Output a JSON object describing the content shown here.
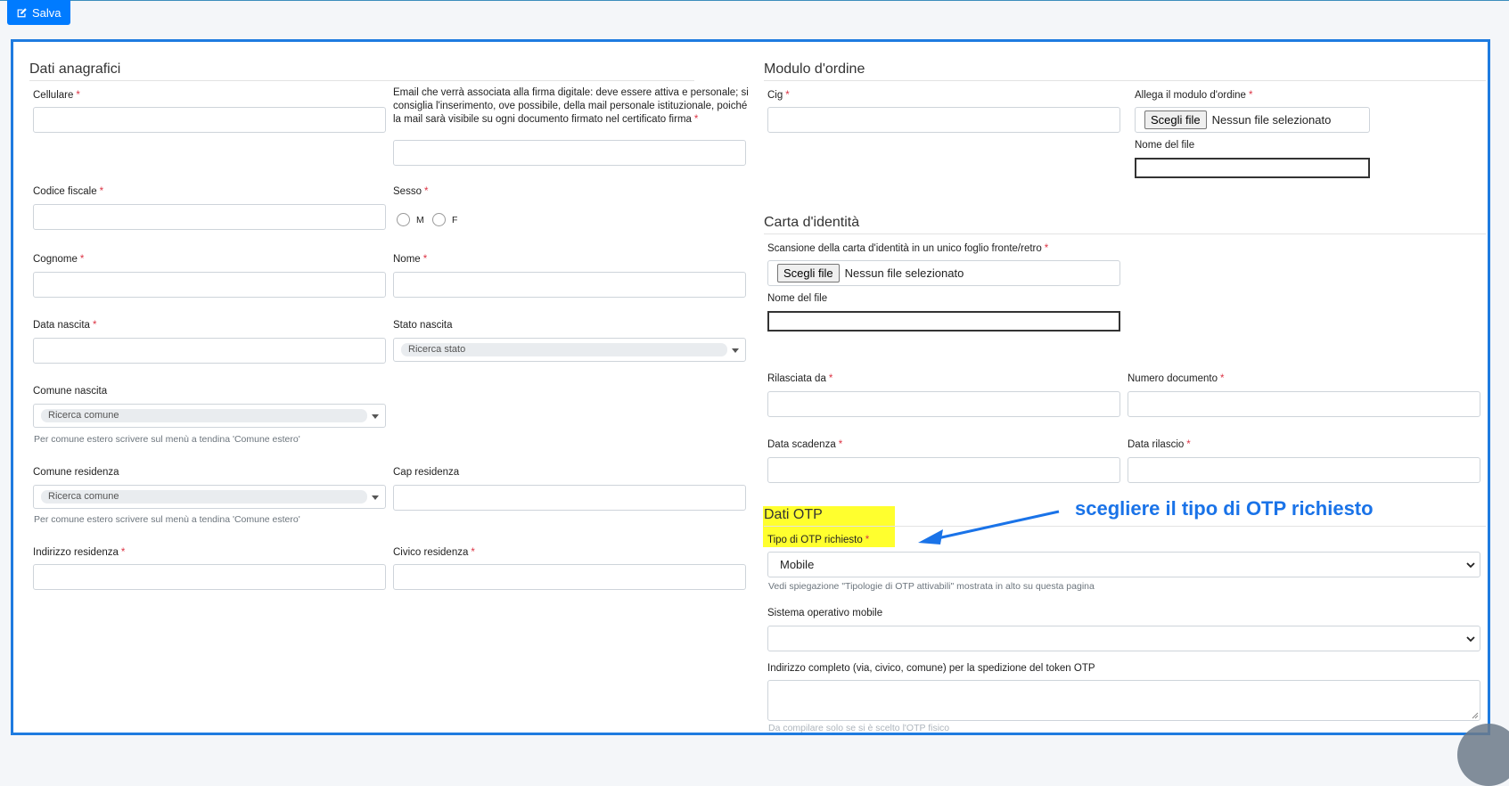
{
  "toolbar": {
    "save_label": "Salva"
  },
  "dati_anagrafici": {
    "title": "Dati anagrafici",
    "cellulare": "Cellulare",
    "email": "Email che verrà associata alla firma digitale: deve essere attiva e personale; si consiglia l'inserimento, ove possibile, della mail personale istituzionale, poiché la mail sarà visibile su ogni documento firmato nel certificato firma",
    "codice_fiscale": "Codice fiscale",
    "sesso": "Sesso",
    "sesso_m": "M",
    "sesso_f": "F",
    "cognome": "Cognome",
    "nome": "Nome",
    "data_nascita": "Data nascita",
    "stato_nascita": "Stato nascita",
    "stato_placeholder": "Ricerca stato",
    "comune_nascita": "Comune nascita",
    "comune_placeholder": "Ricerca comune",
    "comune_help": "Per comune estero scrivere sul menù a tendina 'Comune estero'",
    "comune_residenza": "Comune residenza",
    "cap_residenza": "Cap residenza",
    "indirizzo_residenza": "Indirizzo residenza",
    "civico_residenza": "Civico residenza",
    "required_mark": "*"
  },
  "modulo_ordine": {
    "title": "Modulo d'ordine",
    "cig": "Cig",
    "allega": "Allega il modulo d'ordine",
    "file_button": "Scegli file",
    "file_none": "Nessun file selezionato",
    "nome_file": "Nome del file"
  },
  "carta_identita": {
    "title": "Carta d'identità",
    "scansione": "Scansione della carta d'identità in un unico foglio fronte/retro",
    "nome_file": "Nome del file",
    "rilasciata_da": "Rilasciata da",
    "numero_documento": "Numero documento",
    "data_scadenza": "Data scadenza",
    "data_rilascio": "Data rilascio"
  },
  "dati_otp": {
    "title": "Dati OTP",
    "tipo_otp": "Tipo di OTP richiesto",
    "tipo_otp_value": "Mobile",
    "tipo_otp_help": "Vedi spiegazione \"Tipologie di OTP attivabili\" mostrata in alto su questa pagina",
    "sistema_operativo": "Sistema operativo mobile",
    "sistema_operativo_value": "",
    "indirizzo_token": "Indirizzo completo (via, civico, comune) per la spedizione del token OTP",
    "indirizzo_help": "Da compilare solo se si è scelto l'OTP fisico"
  },
  "annotation": {
    "text": "scegliere il tipo di OTP richiesto",
    "color": "#1a73e8"
  },
  "colors": {
    "primary": "#007bff",
    "frame": "#1e7be0",
    "highlight": "#ffff2e",
    "required": "#dc3545"
  }
}
